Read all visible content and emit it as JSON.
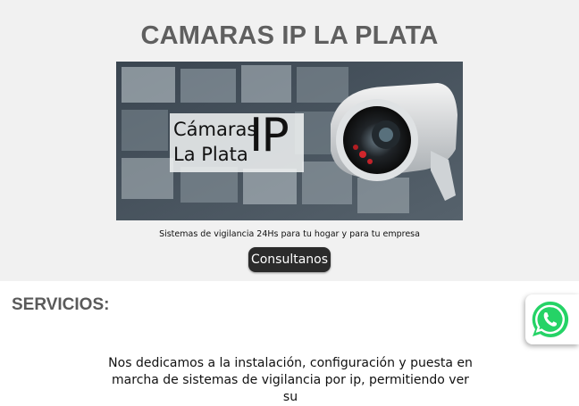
{
  "header": {
    "title": "CAMARAS IP LA PLATA"
  },
  "banner": {
    "line1": "Cámaras",
    "line2": "La Plata",
    "ip": "IP"
  },
  "tagline": "Sistemas de vigilancia 24Hs para tu hogar y para tu empresa",
  "cta": {
    "label": "Consultanos"
  },
  "services": {
    "heading": "SERVICIOS:",
    "description_line1": "Nos dedicamos a la instalación, configuración y puesta en",
    "description_line2": "marcha de sistemas de vigilancia por ip, permitiendo ver su"
  },
  "whatsapp": {
    "icon": "whatsapp-icon",
    "color": "#25d366"
  },
  "colors": {
    "title": "#5f5f5f",
    "cta_bg": "#2b2b2b",
    "hero_bg": "#f1f1f1"
  }
}
